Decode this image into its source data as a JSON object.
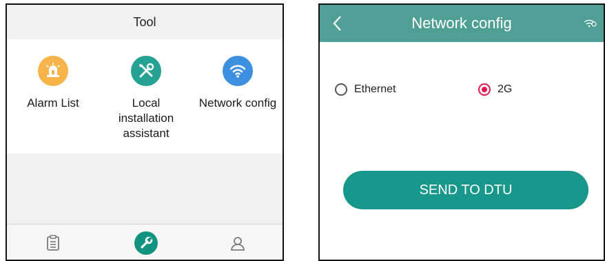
{
  "tool_screen": {
    "header_title": "Tool",
    "items": [
      {
        "label": "Alarm List",
        "icon": "alarm-icon",
        "color": "#f6b44b"
      },
      {
        "label": "Local installation assistant",
        "icon": "tools-icon",
        "color": "#24a394"
      },
      {
        "label": "Network config",
        "icon": "wifi-icon",
        "color": "#3d8fe0"
      }
    ],
    "nav": [
      {
        "icon": "clipboard-icon",
        "active": false
      },
      {
        "icon": "wrench-icon",
        "active": true
      },
      {
        "icon": "user-icon",
        "active": false
      }
    ]
  },
  "network_config": {
    "header_title": "Network config",
    "back_icon": "chevron-left-icon",
    "status_icon": "signal-icon",
    "options": [
      {
        "label": "Ethernet",
        "selected": false
      },
      {
        "label": "2G",
        "selected": true
      }
    ],
    "send_button": "SEND TO DTU",
    "colors": {
      "header": "#4f9f95",
      "button": "#18988a",
      "radio_selected": "#e0174f"
    }
  }
}
